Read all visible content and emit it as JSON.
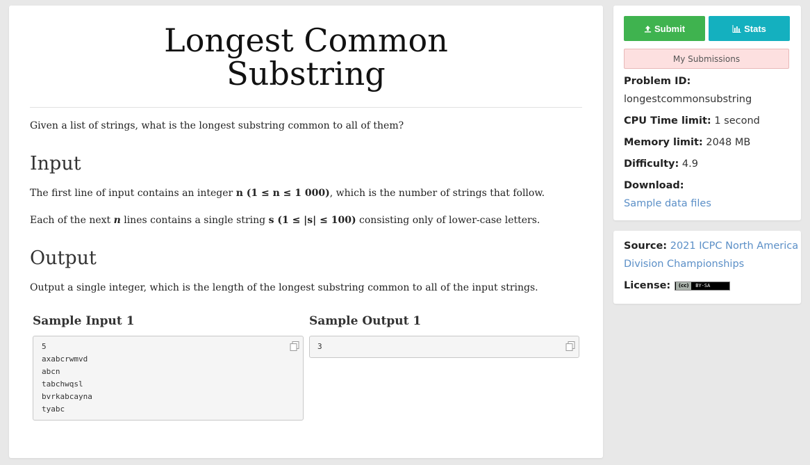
{
  "problem": {
    "title_line1": "Longest Common",
    "title_line2": "Substring",
    "statement": "Given a list of strings, what is the longest substring common to all of them?",
    "input_heading": "Input",
    "input_p1_pre": "The first line of input contains an integer ",
    "input_p1_math": "n (1 ≤ n ≤ 1 000)",
    "input_p1_post": ", which is the number of strings that follow.",
    "input_p2_pre": "Each of the next ",
    "input_p2_n": "n",
    "input_p2_mid": " lines contains a single string ",
    "input_p2_math": "s (1 ≤ |s| ≤ 100)",
    "input_p2_post": " consisting only of lower-case letters.",
    "output_heading": "Output",
    "output_text": "Output a single integer, which is the length of the longest substring common to all of the input strings."
  },
  "samples": {
    "input_heading": "Sample Input 1",
    "output_heading": "Sample Output 1",
    "input_lines": [
      "5",
      "axabcrwmvd",
      "abcn",
      "tabchwqsl",
      "bvrkabcayna",
      "tyabc"
    ],
    "output_lines": [
      "3"
    ],
    "copy_icon": "copy-icon"
  },
  "sidebar": {
    "submit_label": "Submit",
    "submit_icon": "upload-icon",
    "stats_label": "Stats",
    "stats_icon": "bar-chart-icon",
    "my_submissions_label": "My Submissions",
    "problem_id_label": "Problem ID:",
    "problem_id_value": "longestcommonsubstring",
    "cpu_label": "CPU Time limit:",
    "cpu_value": "1 second",
    "memory_label": "Memory limit:",
    "memory_value": "2048 MB",
    "difficulty_label": "Difficulty:",
    "difficulty_value": "4.9",
    "download_label": "Download:",
    "download_link": "Sample data files",
    "source_label": "Source:",
    "source_link_line1": "2021 ICPC North America",
    "source_link_line2": "Division Championships",
    "license_label": "License:",
    "license_badge": "BY-SA",
    "colors": {
      "submit": "#3fb34f",
      "stats": "#14b0bf",
      "link": "#5b8fc7"
    }
  }
}
